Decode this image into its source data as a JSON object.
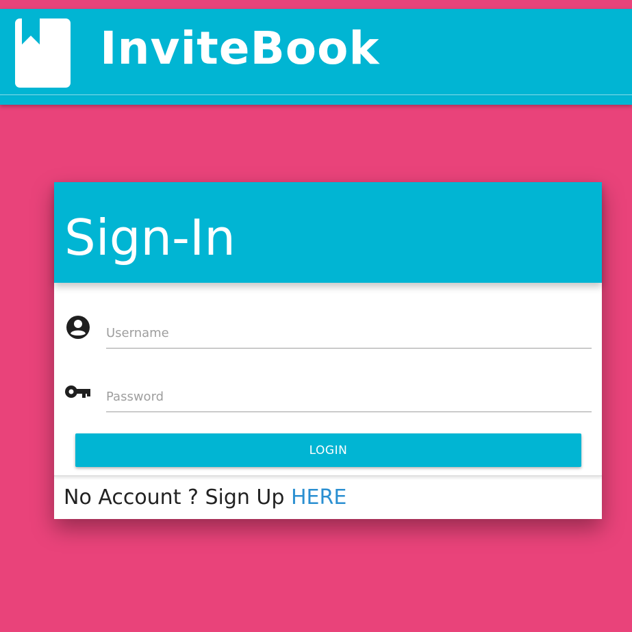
{
  "header": {
    "brand": "InviteBook",
    "logo_icon": "bookmark-book-icon",
    "background_color": "#01b5d3"
  },
  "page": {
    "background_color": "#e9437a"
  },
  "signin": {
    "title": "Sign-In",
    "username": {
      "icon": "account-circle-icon",
      "placeholder": "Username",
      "value": ""
    },
    "password": {
      "icon": "key-icon",
      "placeholder": "Password",
      "value": ""
    },
    "login_label": "LOGIN",
    "signup_prompt": "No Account ? Sign Up ",
    "signup_link": "HERE",
    "link_color": "#2a8fd1"
  }
}
